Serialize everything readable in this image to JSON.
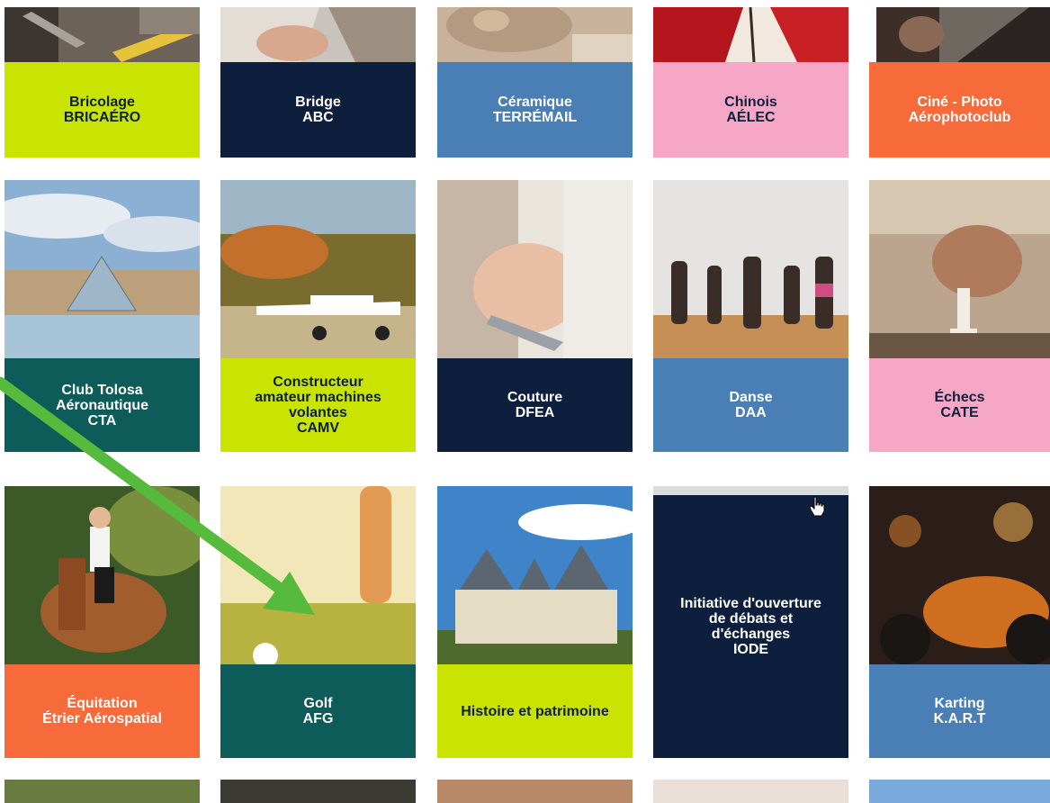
{
  "row1": [
    {
      "line1": "Bricolage",
      "line2": "BRICAÉRO",
      "photo": "tools-photo",
      "accent": "#c9e400"
    },
    {
      "line1": "Bridge",
      "line2": "ABC",
      "photo": "cards-photo",
      "accent": "#0e1f3d"
    },
    {
      "line1": "Céramique",
      "line2": "TERRÉMAIL",
      "photo": "pottery-photo",
      "accent": "#4a7fb5"
    },
    {
      "line1": "Chinois",
      "line2": "AÉLEC",
      "photo": "calligraphy-photo",
      "accent": "#f7a7c6"
    },
    {
      "line1": "Ciné - Photo",
      "line2": "Aérophotoclub",
      "photo": "camera-photo",
      "accent": "#f76a3a"
    }
  ],
  "row2": [
    {
      "lines": [
        "Club Tolosa",
        "Aéronautique",
        "CTA"
      ],
      "photo": "louvre-photo",
      "accent": "#0d5c59"
    },
    {
      "lines": [
        "Constructeur",
        "amateur machines",
        "volantes",
        "CAMV"
      ],
      "photo": "airplane-photo",
      "accent": "#c9e400"
    },
    {
      "lines": [
        "Couture",
        "DFEA"
      ],
      "photo": "sewing-photo",
      "accent": "#0e1f3d"
    },
    {
      "lines": [
        "Danse",
        "DAA"
      ],
      "photo": "dance-photo",
      "accent": "#4a7fb5"
    },
    {
      "lines": [
        "Échecs",
        "CATE"
      ],
      "photo": "chess-photo",
      "accent": "#f7a7c6"
    }
  ],
  "row3": [
    {
      "lines": [
        "Équitation",
        "Étrier Aérospatial"
      ],
      "photo": "horse-photo",
      "accent": "#f76a3a"
    },
    {
      "lines": [
        "Golf",
        "AFG"
      ],
      "photo": "golf-photo",
      "accent": "#0d5c59"
    },
    {
      "lines": [
        "Histoire et patrimoine"
      ],
      "photo": "castle-photo",
      "accent": "#c9e400"
    },
    {
      "lines": [
        "Initiative d'ouverture",
        "de débats et",
        "d'échanges",
        "IODE"
      ],
      "photo": "",
      "accent": "#0e1f3d"
    },
    {
      "lines": [
        "Karting",
        "K.A.R.T"
      ],
      "photo": "karting-photo",
      "accent": "#4a7fb5"
    }
  ]
}
